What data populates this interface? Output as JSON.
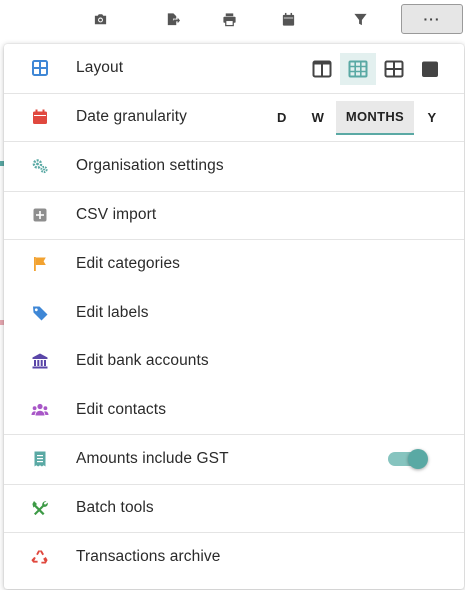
{
  "toolbar": {
    "buttons": [
      {
        "name": "camera-icon"
      },
      {
        "name": "export-icon"
      },
      {
        "name": "print-icon"
      },
      {
        "name": "calendar-icon"
      },
      {
        "name": "filter-icon"
      },
      {
        "name": "more-horiz-icon",
        "glyph": "···"
      }
    ]
  },
  "menu": {
    "layout": {
      "label": "Layout"
    },
    "date_granularity": {
      "label": "Date granularity",
      "options": [
        "D",
        "W",
        "MONTHS",
        "Y"
      ],
      "selected": "MONTHS"
    },
    "organisation_settings": {
      "label": "Organisation settings"
    },
    "csv_import": {
      "label": "CSV import"
    },
    "edit_categories": {
      "label": "Edit categories"
    },
    "edit_labels": {
      "label": "Edit labels"
    },
    "edit_bank_accounts": {
      "label": "Edit bank accounts"
    },
    "edit_contacts": {
      "label": "Edit contacts"
    },
    "amounts_include_gst": {
      "label": "Amounts include GST",
      "enabled": true
    },
    "batch_tools": {
      "label": "Batch tools"
    },
    "transactions_archive": {
      "label": "Transactions archive"
    }
  },
  "colors": {
    "accent": "#5aa9a4",
    "layout_icon": "#3f87d6",
    "date_icon": "#e0483e",
    "org_icon": "#5aa9a4",
    "csv_icon": "#8e8e8e",
    "categories_icon": "#f2a230",
    "labels_icon": "#3f87d6",
    "bank_icon": "#5a46a8",
    "contacts_icon": "#a857c7",
    "gst_icon": "#5aa9a4",
    "batch_icon": "#3d9a46",
    "archive_icon": "#e0483e"
  }
}
